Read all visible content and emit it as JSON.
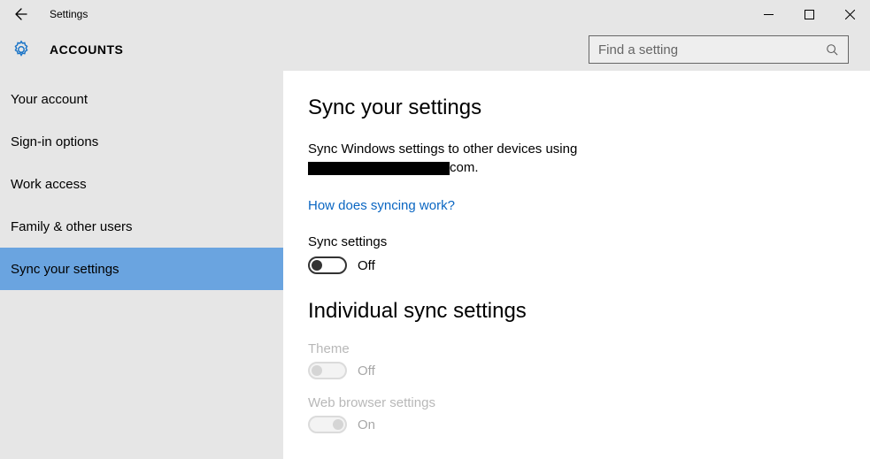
{
  "titlebar": {
    "title": "Settings"
  },
  "header": {
    "title": "ACCOUNTS",
    "search_placeholder": "Find a setting"
  },
  "sidebar": {
    "items": [
      {
        "label": "Your account"
      },
      {
        "label": "Sign-in options"
      },
      {
        "label": "Work access"
      },
      {
        "label": "Family & other users"
      },
      {
        "label": "Sync your settings"
      }
    ],
    "selected_index": 4
  },
  "content": {
    "heading": "Sync your settings",
    "desc_line1": "Sync Windows settings to other devices using",
    "desc_suffix": "com.",
    "link": "How does syncing work?",
    "sync_label": "Sync settings",
    "sync_state": "Off",
    "sub_heading": "Individual sync settings",
    "theme_label": "Theme",
    "theme_state": "Off",
    "webbrowser_label": "Web browser settings",
    "webbrowser_state": "On"
  }
}
